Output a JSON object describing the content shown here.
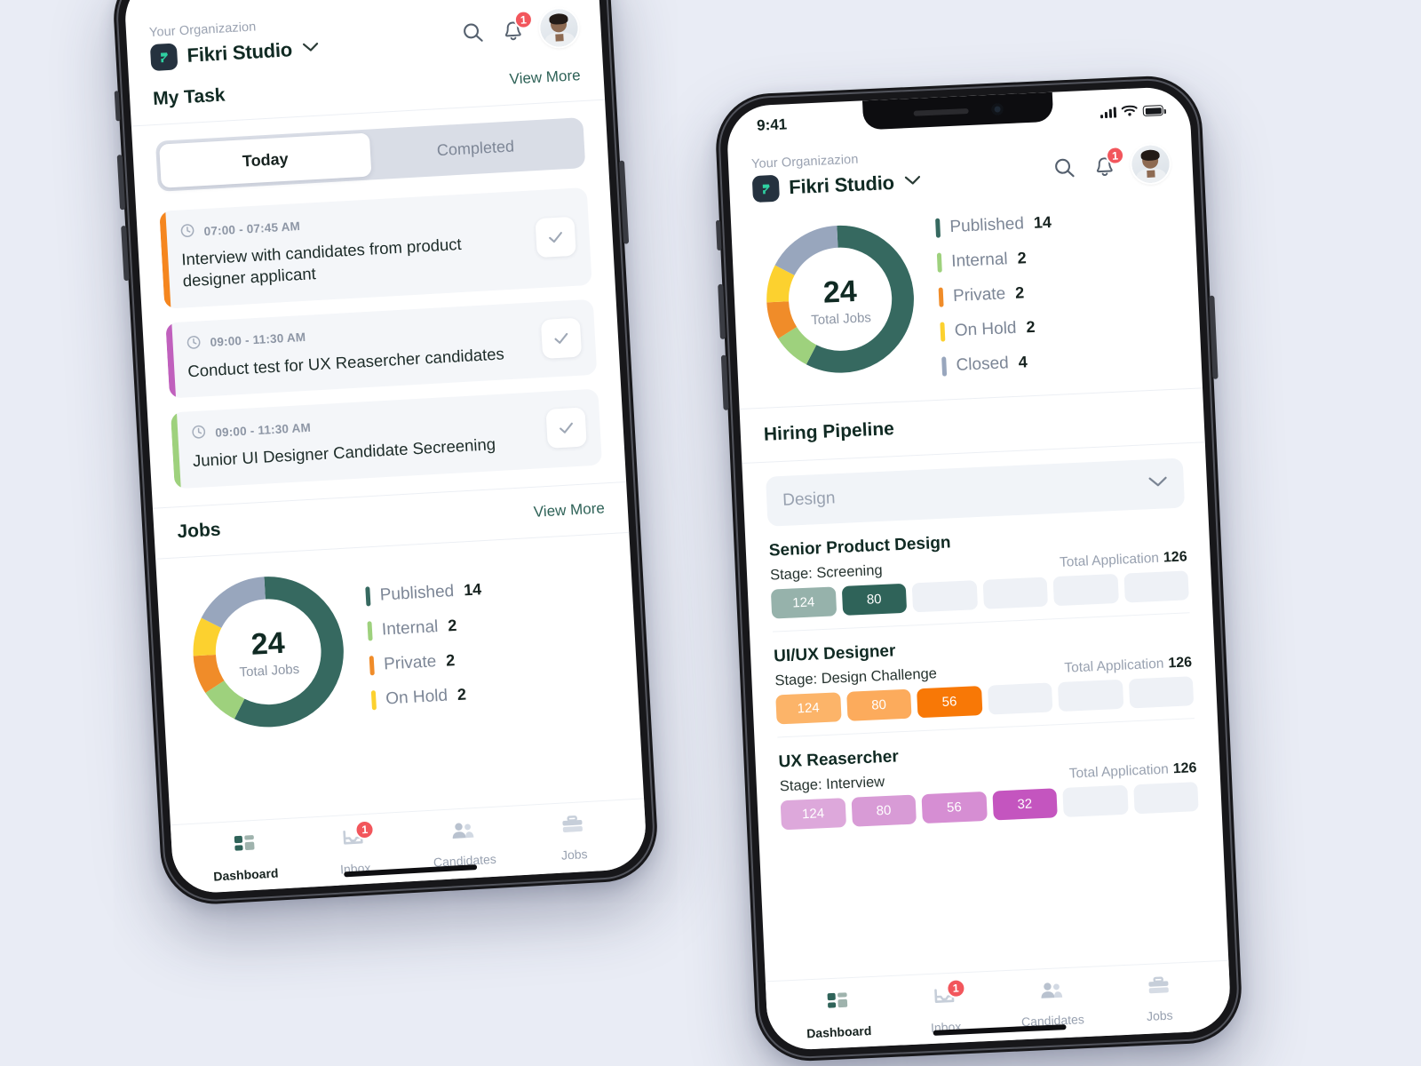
{
  "background_color": "#e9ecf5",
  "brand": {
    "accent_green": "#2f6359",
    "logo_letter": "F"
  },
  "header": {
    "org_label": "Your Organizazion",
    "org_name": "Fikri Studio",
    "search_icon": "search-icon",
    "bell_icon": "bell-icon",
    "notification_count": "1",
    "chevron_icon": "chevron-down-icon",
    "avatar": "user-avatar"
  },
  "status_bar": {
    "time": "9:41",
    "signal": "signal-icon",
    "wifi": "wifi-icon",
    "battery": "battery-icon"
  },
  "left_phone": {
    "my_task": {
      "title": "My Task",
      "view_more": "View More"
    },
    "toggle": {
      "options": [
        "Today",
        "Completed"
      ],
      "selected": "Today"
    },
    "tasks": [
      {
        "time": "07:00 - 07:45 AM",
        "text": "Interview with candidates from product designer applicant",
        "stripe_color": "#f5861f",
        "check_icon": "check-icon"
      },
      {
        "time": "09:00 - 11:30 AM",
        "text": "Conduct test for UX Reasercher candidates",
        "stripe_color": "#c060bd",
        "check_icon": "check-icon"
      },
      {
        "time": "09:00 - 11:30 AM",
        "text": "Junior UI Designer Candidate Secreening",
        "stripe_color": "#9ed17d",
        "check_icon": "check-icon"
      }
    ],
    "jobs": {
      "title": "Jobs",
      "view_more": "View More"
    }
  },
  "chart_data": {
    "type": "pie",
    "title": "Total Jobs",
    "center_value": "24",
    "center_label": "Total Jobs",
    "categories": [
      "Published",
      "Internal",
      "Private",
      "On Hold",
      "Closed"
    ],
    "values": [
      14,
      2,
      2,
      2,
      4
    ],
    "colors": [
      "#366960",
      "#9ed17d",
      "#f08c29",
      "#fcd12f",
      "#98a6bd"
    ],
    "legend_position": "right",
    "total": 24
  },
  "right_phone": {
    "pipeline": {
      "title": "Hiring Pipeline",
      "filter_value": "Design",
      "filter_chevron": "chevron-down-icon",
      "total_label": "Total Application",
      "slot_count": 6,
      "rows": [
        {
          "job": "Senior Product Design",
          "stage": "Stage: Screening",
          "total_application": "126",
          "filled": [
            {
              "value": "124",
              "color": "#96b2ab"
            },
            {
              "value": "80",
              "color": "#2f6359"
            }
          ]
        },
        {
          "job": "UI/UX Designer",
          "stage": "Stage: Design Challenge",
          "total_application": "126",
          "filled": [
            {
              "value": "124",
              "color": "#fcb469"
            },
            {
              "value": "80",
              "color": "#fcab5c"
            },
            {
              "value": "56",
              "color": "#f87806"
            }
          ]
        },
        {
          "job": "UX Reasercher",
          "stage": "Stage: Interview",
          "total_application": "126",
          "filled": [
            {
              "value": "124",
              "color": "#dda8db"
            },
            {
              "value": "80",
              "color": "#d89bd6"
            },
            {
              "value": "56",
              "color": "#d68ed3"
            },
            {
              "value": "32",
              "color": "#c455bf"
            }
          ]
        }
      ]
    }
  },
  "bottom_nav": {
    "items": [
      {
        "label": "Dashboard",
        "icon": "dashboard-icon",
        "active": true,
        "badge": null
      },
      {
        "label": "Inbox",
        "icon": "inbox-icon",
        "active": false,
        "badge": "1"
      },
      {
        "label": "Candidates",
        "icon": "people-icon",
        "active": false,
        "badge": null
      },
      {
        "label": "Jobs",
        "icon": "briefcase-icon",
        "active": false,
        "badge": null
      }
    ]
  }
}
